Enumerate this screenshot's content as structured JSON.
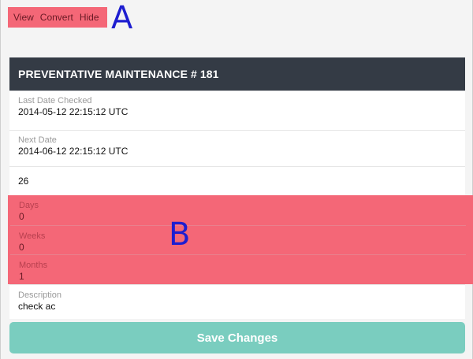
{
  "top_links": {
    "view": "View",
    "convert": "Convert",
    "hide": "Hide"
  },
  "annotations": {
    "a": "A",
    "b": "B"
  },
  "header": {
    "title": "PREVENTATIVE MAINTENANCE # 181"
  },
  "fields": {
    "last_date_checked": {
      "label": "Last Date Checked",
      "value": "2014-05-12 22:15:12 UTC"
    },
    "next_date": {
      "label": "Next Date",
      "value": "2014-06-12 22:15:12 UTC"
    },
    "number": {
      "value": "26"
    },
    "days": {
      "label": "Days",
      "value": "0"
    },
    "weeks": {
      "label": "Weeks",
      "value": "0"
    },
    "months": {
      "label": "Months",
      "value": "1"
    },
    "description": {
      "label": "Description",
      "value": "check ac"
    }
  },
  "save_button": {
    "label": "Save Changes"
  },
  "colors": {
    "highlight": "#f46777",
    "header_bg": "#343b45",
    "save_button": "#7acdbf",
    "annotation_letter": "#1e1ed0"
  }
}
